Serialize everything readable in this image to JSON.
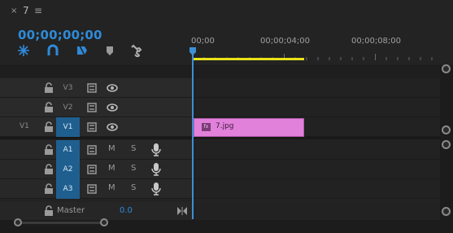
{
  "tab": {
    "close_glyph": "×",
    "title": "7",
    "menu_glyph": "≡"
  },
  "timecode": "00;00;00;00",
  "tools": [
    {
      "icon": "snap-icon"
    },
    {
      "icon": "linked-selection-icon"
    },
    {
      "icon": "add-marker-icon"
    },
    {
      "icon": "marker-icon"
    },
    {
      "icon": "wrench-icon"
    }
  ],
  "ruler": {
    "labels": [
      "00;00",
      "00;00;04;00",
      "00;00;08;00"
    ]
  },
  "video_tracks": [
    {
      "source": "",
      "target": "V3",
      "active": false
    },
    {
      "source": "",
      "target": "V2",
      "active": false
    },
    {
      "source": "V1",
      "target": "V1",
      "active": true
    }
  ],
  "audio_tracks": [
    {
      "target": "A1",
      "mute": "M",
      "solo": "S"
    },
    {
      "target": "A2",
      "mute": "M",
      "solo": "S"
    },
    {
      "target": "A3",
      "mute": "M",
      "solo": "S"
    }
  ],
  "master": {
    "label": "Master",
    "value": "0.0"
  },
  "clip": {
    "name": "7.jpg",
    "fx": "fx",
    "color": "#e181da"
  },
  "colors": {
    "accent": "#2f8ad8",
    "work_area": "#e8e218",
    "target_active": "#1f5f8f"
  }
}
